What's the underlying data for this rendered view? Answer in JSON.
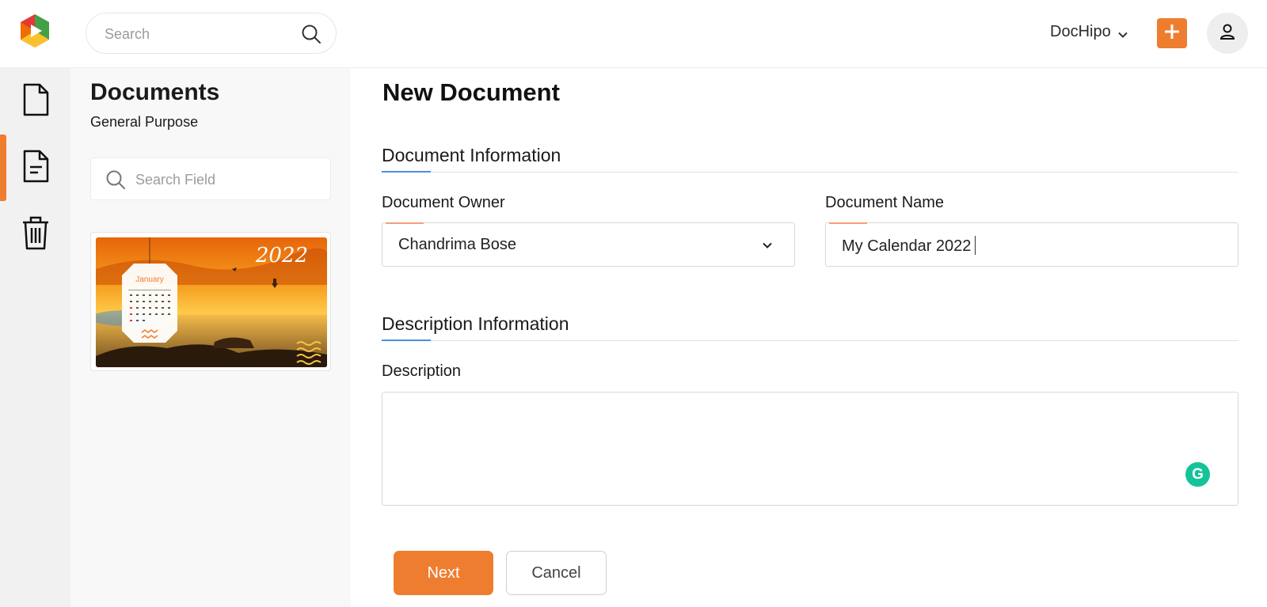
{
  "header": {
    "search_placeholder": "Search",
    "workspace": "DocHipo",
    "add_icon": "plus-icon",
    "user_icon": "user-icon",
    "accent_color": "#ee7d2f"
  },
  "rail": {
    "items": [
      {
        "icon": "document-icon",
        "active": false
      },
      {
        "icon": "document-lines-icon",
        "active": true
      },
      {
        "icon": "trash-icon",
        "active": false
      }
    ]
  },
  "panel": {
    "title": "Documents",
    "subtitle": "General Purpose",
    "search_placeholder": "Search Field",
    "thumbnail": {
      "year": "2022",
      "month": "January"
    }
  },
  "form": {
    "title": "New Document",
    "sections": {
      "document_info": "Document Information",
      "description_info": "Description Information"
    },
    "owner_label": "Document Owner",
    "owner_value": "Chandrima Bose",
    "name_label": "Document Name",
    "name_value": "My Calendar 2022",
    "description_label": "Description",
    "description_value": "",
    "next_label": "Next",
    "cancel_label": "Cancel"
  }
}
